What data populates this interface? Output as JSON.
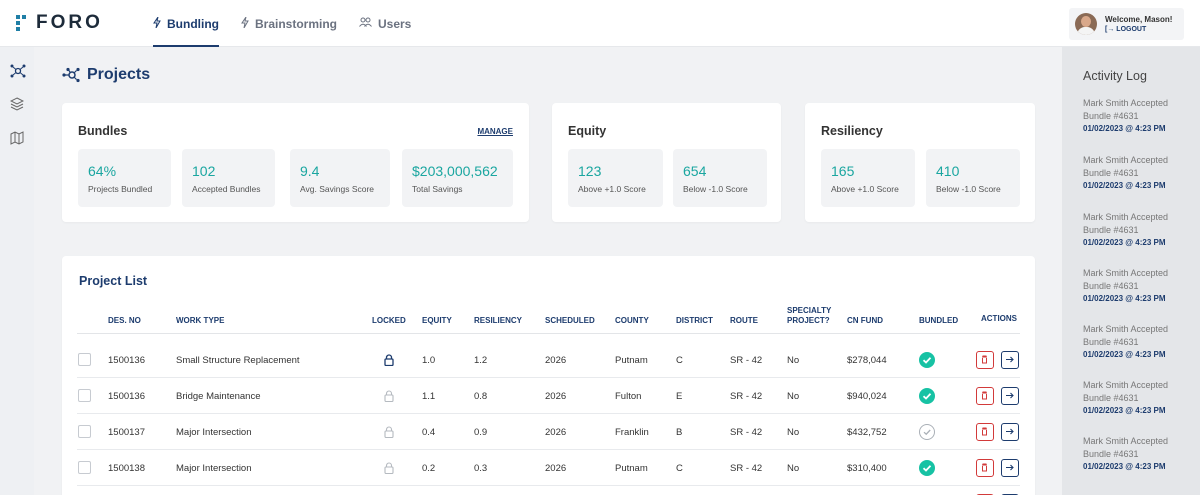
{
  "app": {
    "logo": "FORO"
  },
  "nav": {
    "items": [
      {
        "label": "Bundling",
        "icon": "lightning-icon",
        "active": true
      },
      {
        "label": "Brainstorming",
        "icon": "lightning-icon",
        "active": false
      },
      {
        "label": "Users",
        "icon": "users-icon",
        "active": false
      }
    ]
  },
  "user": {
    "welcome": "Welcome, Mason!",
    "logout": "LOGOUT"
  },
  "page": {
    "title": "Projects"
  },
  "bundles": {
    "title": "Bundles",
    "manage": "MANAGE",
    "stats": [
      {
        "value": "64%",
        "label": "Projects Bundled"
      },
      {
        "value": "102",
        "label": "Accepted Bundles"
      },
      {
        "value": "9.4",
        "label": "Avg. Savings Score"
      },
      {
        "value": "$203,000,562",
        "label": "Total Savings"
      }
    ]
  },
  "equity": {
    "title": "Equity",
    "stats": [
      {
        "value": "123",
        "label": "Above +1.0 Score"
      },
      {
        "value": "654",
        "label": "Below -1.0 Score"
      }
    ]
  },
  "resiliency": {
    "title": "Resiliency",
    "stats": [
      {
        "value": "165",
        "label": "Above +1.0 Score"
      },
      {
        "value": "410",
        "label": "Below -1.0 Score"
      }
    ]
  },
  "project_list": {
    "title": "Project List",
    "headers": {
      "des_no": "DES. NO",
      "work_type": "WORK TYPE",
      "locked": "LOCKED",
      "equity": "EQUITY",
      "resiliency": "RESILIENCY",
      "scheduled": "SCHEDULED",
      "county": "COUNTY",
      "district": "DISTRICT",
      "route": "ROUTE",
      "specialty_1": "SPECIALTY",
      "specialty_2": "PROJECT?",
      "cn_fund": "CN FUND",
      "bundled": "BUNDLED",
      "actions": "ACTIONS"
    },
    "rows": [
      {
        "des_no": "1500136",
        "work_type": "Small Structure Replacement",
        "locked": true,
        "equity": "1.0",
        "resiliency": "1.2",
        "scheduled": "2026",
        "county": "Putnam",
        "district": "C",
        "route": "SR - 42",
        "specialty": "No",
        "cn_fund": "$278,044",
        "bundled": true
      },
      {
        "des_no": "1500136",
        "work_type": "Bridge Maintenance",
        "locked": false,
        "equity": "1.1",
        "resiliency": "0.8",
        "scheduled": "2026",
        "county": "Fulton",
        "district": "E",
        "route": "SR - 42",
        "specialty": "No",
        "cn_fund": "$940,024",
        "bundled": true
      },
      {
        "des_no": "1500137",
        "work_type": "Major Intersection",
        "locked": false,
        "equity": "0.4",
        "resiliency": "0.9",
        "scheduled": "2026",
        "county": "Franklin",
        "district": "B",
        "route": "SR - 42",
        "specialty": "No",
        "cn_fund": "$432,752",
        "bundled": false
      },
      {
        "des_no": "1500138",
        "work_type": "Major Intersection",
        "locked": false,
        "equity": "0.2",
        "resiliency": "0.3",
        "scheduled": "2026",
        "county": "Putnam",
        "district": "C",
        "route": "SR - 42",
        "specialty": "No",
        "cn_fund": "$310,400",
        "bundled": true
      }
    ]
  },
  "activity": {
    "title": "Activity Log",
    "entries": [
      {
        "line1": "Mark Smith Accepted",
        "line2": "Bundle #4631",
        "date": "01/02/2023 @ 4:23 PM"
      },
      {
        "line1": "Mark Smith Accepted",
        "line2": "Bundle #4631",
        "date": "01/02/2023 @ 4:23 PM"
      },
      {
        "line1": "Mark Smith Accepted",
        "line2": "Bundle #4631",
        "date": "01/02/2023 @ 4:23 PM"
      },
      {
        "line1": "Mark Smith Accepted",
        "line2": "Bundle #4631",
        "date": "01/02/2023 @ 4:23 PM"
      },
      {
        "line1": "Mark Smith Accepted",
        "line2": "Bundle #4631",
        "date": "01/02/2023 @ 4:23 PM"
      },
      {
        "line1": "Mark Smith Accepted",
        "line2": "Bundle #4631",
        "date": "01/02/2023 @ 4:23 PM"
      },
      {
        "line1": "Mark Smith Accepted",
        "line2": "Bundle #4631",
        "date": "01/02/2023 @ 4:23 PM"
      }
    ]
  },
  "colors": {
    "accent": "#1d3c6e",
    "teal": "#1aa6a0",
    "success": "#17c2a4",
    "danger": "#d23a3a"
  }
}
